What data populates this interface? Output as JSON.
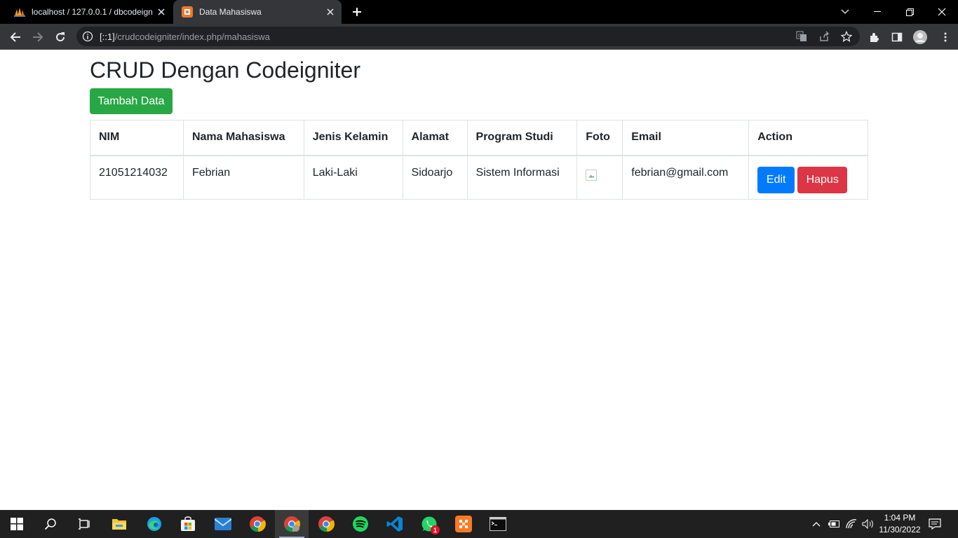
{
  "browser": {
    "tabs": [
      {
        "title": "localhost / 127.0.0.1 / dbcodeign",
        "icon": "phpmyadmin-icon",
        "active": false
      },
      {
        "title": "Data Mahasiswa",
        "icon": "codeigniter-icon",
        "active": true
      }
    ],
    "url": {
      "host": "[::1]",
      "path": "/crudcodeigniter/index.php/mahasiswa"
    }
  },
  "page": {
    "title": "CRUD Dengan Codeigniter",
    "add_button": "Tambah Data",
    "table": {
      "headers": [
        "NIM",
        "Nama Mahasiswa",
        "Jenis Kelamin",
        "Alamat",
        "Program Studi",
        "Foto",
        "Email",
        "Action"
      ],
      "rows": [
        {
          "nim": "21051214032",
          "nama": "Febrian",
          "jenis_kelamin": "Laki-Laki",
          "alamat": "Sidoarjo",
          "program_studi": "Sistem Informasi",
          "foto": "broken-image-icon",
          "email": "febrian@gmail.com",
          "edit_label": "Edit",
          "delete_label": "Hapus"
        }
      ]
    },
    "colors": {
      "success": "#28a745",
      "primary": "#007bff",
      "danger": "#dc3545"
    }
  },
  "taskbar": {
    "apps": [
      "start-icon",
      "search-icon",
      "task-view-icon",
      "file-explorer-icon",
      "edge-icon",
      "store-icon",
      "mail-icon",
      "chrome-icon",
      "chrome-icon",
      "chrome-icon",
      "spotify-icon",
      "vscode-icon",
      "whatsapp-icon",
      "xampp-icon",
      "terminal-icon"
    ],
    "whatsapp_badge": "1",
    "time": "1:04 PM",
    "date": "11/30/2022"
  }
}
